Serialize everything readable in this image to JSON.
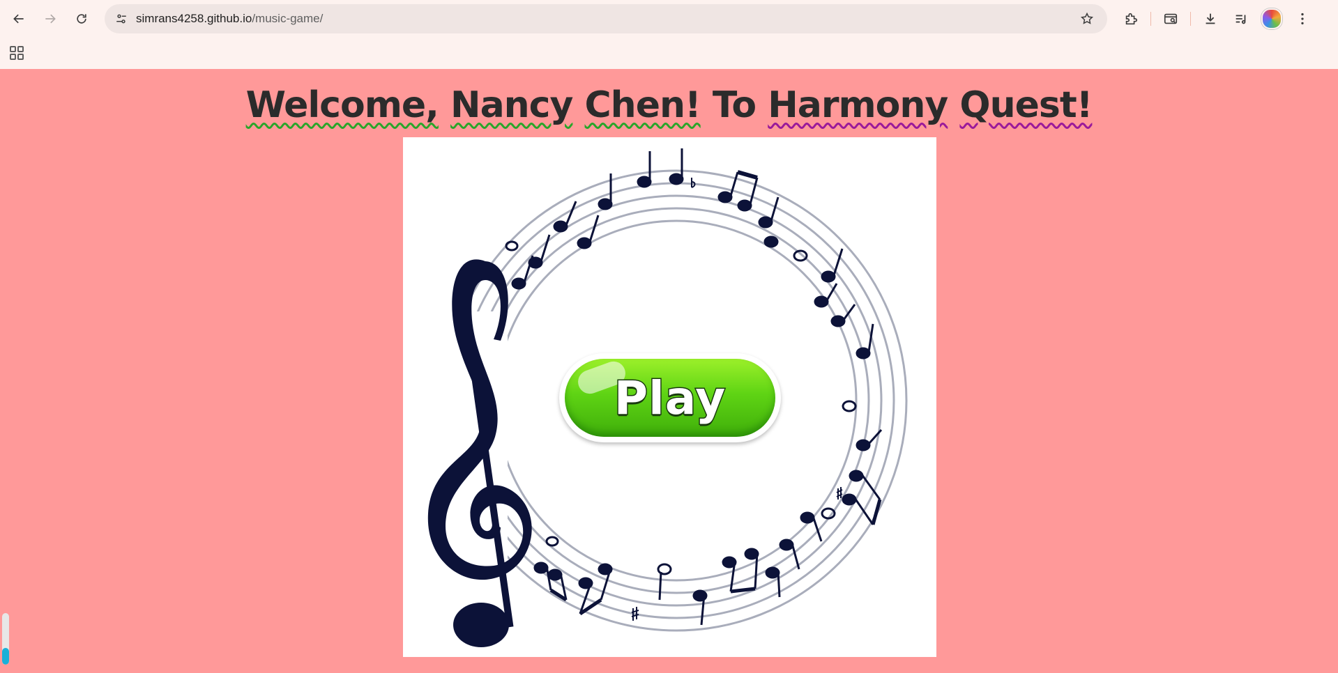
{
  "browser": {
    "url_host": "simrans4258.github.io",
    "url_path": "/music-game/",
    "icons": {
      "back": "back-arrow-icon",
      "forward": "forward-arrow-icon",
      "reload": "reload-icon",
      "site_info": "tune-icon",
      "bookmark": "star-icon",
      "extensions": "puzzle-icon",
      "lens": "search-tab-icon",
      "downloads": "download-icon",
      "media": "media-queue-icon",
      "menu": "kebab-menu-icon",
      "apps": "apps-grid-icon"
    }
  },
  "page": {
    "background": "#ff9999",
    "title_parts": {
      "greeting": "Welcome,",
      "first_name": "Nancy",
      "last_name": "Chen!",
      "to": "To",
      "harmony": "Harmony",
      "quest": "Quest!"
    },
    "play_button_label": "Play"
  }
}
